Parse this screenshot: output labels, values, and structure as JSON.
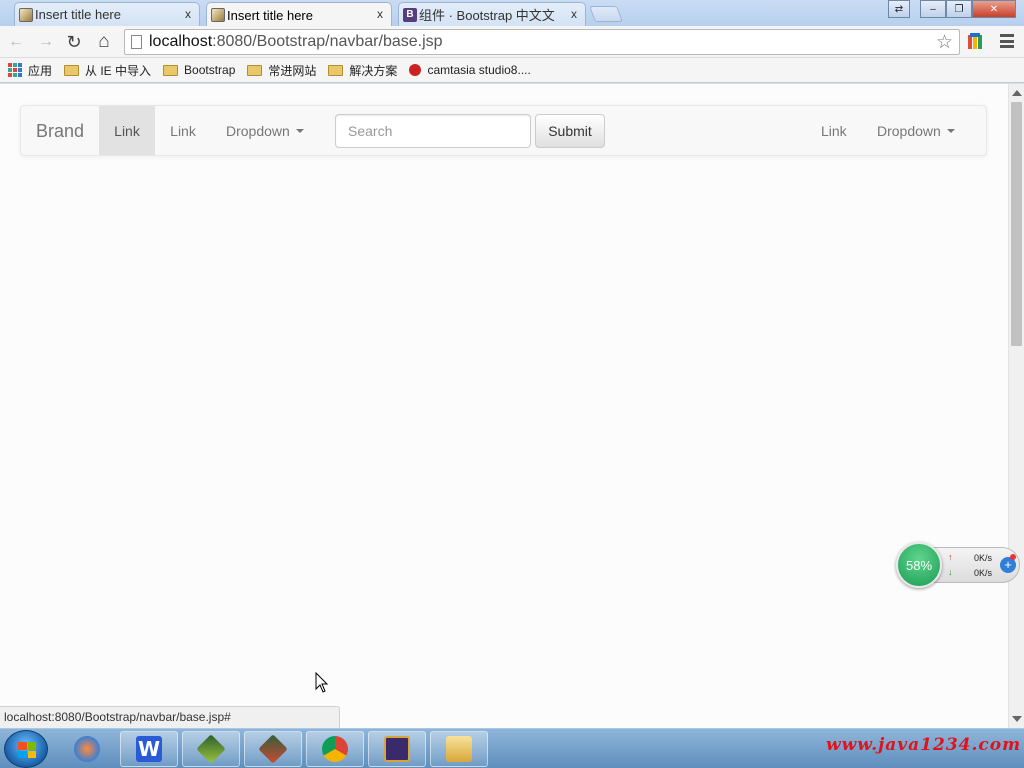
{
  "browser": {
    "tabs": [
      {
        "title": "Insert title here",
        "active": false,
        "favicon": "page-icon"
      },
      {
        "title": "Insert title here",
        "active": true,
        "favicon": "page-icon"
      },
      {
        "title": "组件 · Bootstrap 中文文",
        "active": false,
        "favicon": "bootstrap-icon",
        "favicon_letter": "B"
      }
    ],
    "close_glyph": "x",
    "window_controls": {
      "switch": "⇄",
      "minimize": "–",
      "maximize": "❐",
      "close": "✕"
    },
    "toolbar": {
      "back_icon": "←",
      "forward_icon": "→",
      "reload_icon": "↻",
      "home_icon": "⌂",
      "url_host": "localhost",
      "url_rest": ":8080/Bootstrap/navbar/base.jsp",
      "star_icon": "☆"
    },
    "bookmarks": [
      {
        "label": "应用",
        "icon": "apps-icon"
      },
      {
        "label": "从 IE 中导入",
        "icon": "folder-icon"
      },
      {
        "label": "Bootstrap",
        "icon": "folder-icon"
      },
      {
        "label": "常进网站",
        "icon": "folder-icon"
      },
      {
        "label": "解决方案",
        "icon": "folder-icon"
      },
      {
        "label": "camtasia studio8....",
        "icon": "camtasia-icon"
      }
    ],
    "status_url": "localhost:8080/Bootstrap/navbar/base.jsp#"
  },
  "navbar": {
    "brand": "Brand",
    "left_links": [
      {
        "label": "Link",
        "active": true
      },
      {
        "label": "Link",
        "active": false
      }
    ],
    "left_dropdown": "Dropdown",
    "search_placeholder": "Search",
    "submit_label": "Submit",
    "right_link": "Link",
    "right_dropdown": "Dropdown"
  },
  "speed_widget": {
    "percent": "58%",
    "up_rate": "0K/s",
    "down_rate": "0K/s",
    "up_arrow": "↑",
    "down_arrow": "↓",
    "plus": "+"
  },
  "taskbar": {
    "apps": [
      "windows-start",
      "wps-writer-icon",
      "app-icon-1",
      "app-icon-2",
      "chrome-icon",
      "java-ee-ide-icon",
      "explorer-icon"
    ],
    "watermark": "www.java1234.com"
  }
}
